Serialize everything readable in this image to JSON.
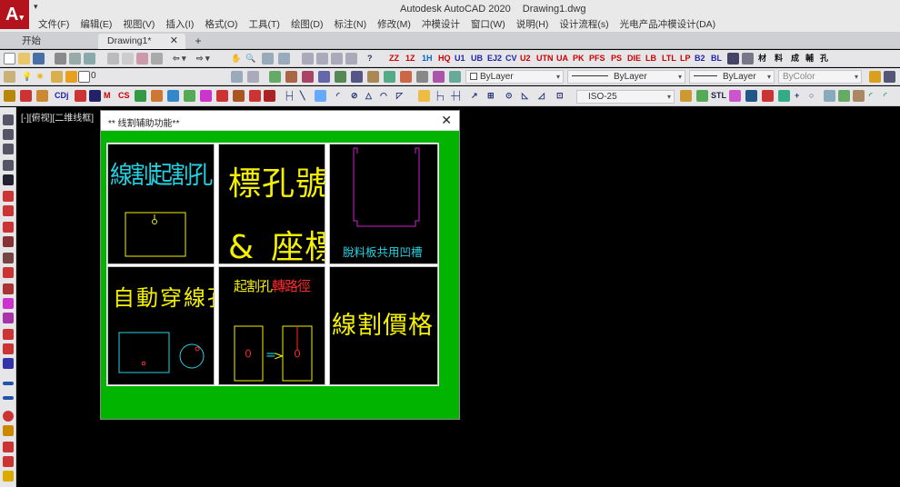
{
  "window": {
    "title_app": "Autodesk AutoCAD 2020",
    "title_file": "Drawing1.dwg",
    "app_logo": "A"
  },
  "menu": [
    "文件(F)",
    "编辑(E)",
    "视图(V)",
    "插入(I)",
    "格式(O)",
    "工具(T)",
    "绘图(D)",
    "标注(N)",
    "修改(M)",
    "冲模设计",
    "窗口(W)",
    "说明(H)",
    "设计流程(s)",
    "光电产品冲模设计(DA)"
  ],
  "tabs": {
    "start": "开始",
    "document": "Drawing1*",
    "close": "✕",
    "new": "+"
  },
  "toolbar": {
    "custom_labels": [
      "ZZ",
      "1Z",
      "1H",
      "HQ",
      "U1",
      "UB",
      "EJ2",
      "CV",
      "U2",
      "UTN",
      "UA",
      "PK",
      "PFS",
      "PS",
      "DIE",
      "LB",
      "LTL",
      "LP",
      "B2",
      "BL"
    ],
    "custom_chinese": [
      "材",
      "料",
      "成",
      "輔",
      "孔"
    ],
    "layer_value": "0",
    "color_value": "ByLayer",
    "linetype_value": "ByLayer",
    "lineweight_value": "ByLayer",
    "plotstyle_value": "ByColor",
    "dimstyle_value": "ISO-25",
    "dim_label": "STL"
  },
  "viewport": {
    "label": "[-][俯视][二维线框]"
  },
  "dialog": {
    "title": "** 线割辅助功能**",
    "close": "✕",
    "cells": {
      "c1": {
        "caption": "線割起割孔"
      },
      "c2": {
        "line1": "標孔號",
        "amp": "&",
        "line2": "座標"
      },
      "c3": {
        "caption": "脫料板共用凹槽"
      },
      "c4": {
        "caption": "自動穿線孔"
      },
      "c5": {
        "caption_a": "起割孔",
        "caption_b": "轉路徑"
      },
      "c6": {
        "caption": "線割價格"
      }
    }
  },
  "colors": {
    "dialog_bg": "#00b400",
    "cyan_text": "#22d3e3",
    "yellow_text": "#f4f000",
    "red_text": "#ff2a2a",
    "magenta_line": "#d020d0",
    "app_red": "#b3131c"
  }
}
